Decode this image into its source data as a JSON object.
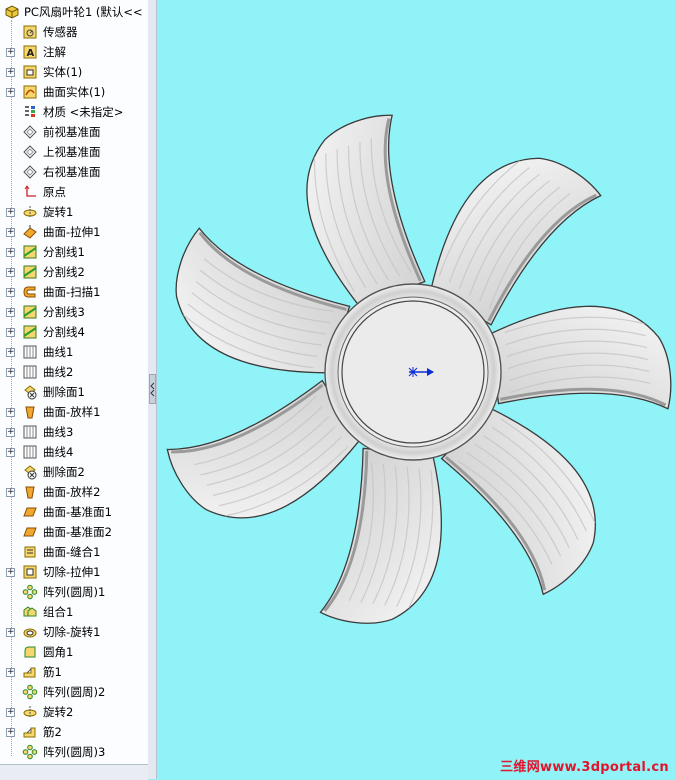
{
  "tree": {
    "root": "PC风扇叶轮1 (默认<<",
    "items": [
      {
        "label": "传感器",
        "icon": "sensor-icon",
        "exp": false
      },
      {
        "label": "注解",
        "icon": "annotation-icon",
        "exp": true
      },
      {
        "label": "实体(1)",
        "icon": "solid-bodies-icon",
        "exp": true
      },
      {
        "label": "曲面实体(1)",
        "icon": "surface-bodies-icon",
        "exp": true
      },
      {
        "label": "材质 <未指定>",
        "icon": "material-icon",
        "exp": false
      },
      {
        "label": "前视基准面",
        "icon": "plane-icon",
        "exp": false
      },
      {
        "label": "上视基准面",
        "icon": "plane-icon",
        "exp": false
      },
      {
        "label": "右视基准面",
        "icon": "plane-icon",
        "exp": false
      },
      {
        "label": "原点",
        "icon": "origin-icon",
        "exp": false
      },
      {
        "label": "旋转1",
        "icon": "revolve-icon",
        "exp": true
      },
      {
        "label": "曲面-拉伸1",
        "icon": "surface-extrude-icon",
        "exp": true
      },
      {
        "label": "分割线1",
        "icon": "split-line-icon",
        "exp": true
      },
      {
        "label": "分割线2",
        "icon": "split-line-icon",
        "exp": true
      },
      {
        "label": "曲面-扫描1",
        "icon": "surface-sweep-icon",
        "exp": true
      },
      {
        "label": "分割线3",
        "icon": "split-line-icon",
        "exp": true
      },
      {
        "label": "分割线4",
        "icon": "split-line-icon",
        "exp": true
      },
      {
        "label": "曲线1",
        "icon": "curve-icon",
        "exp": true
      },
      {
        "label": "曲线2",
        "icon": "curve-icon",
        "exp": true
      },
      {
        "label": "删除面1",
        "icon": "delete-face-icon",
        "exp": false
      },
      {
        "label": "曲面-放样1",
        "icon": "surface-loft-icon",
        "exp": true
      },
      {
        "label": "曲线3",
        "icon": "curve-icon",
        "exp": true
      },
      {
        "label": "曲线4",
        "icon": "curve-icon",
        "exp": true
      },
      {
        "label": "删除面2",
        "icon": "delete-face-icon",
        "exp": false
      },
      {
        "label": "曲面-放样2",
        "icon": "surface-loft-icon",
        "exp": true
      },
      {
        "label": "曲面-基准面1",
        "icon": "planar-surface-icon",
        "exp": false
      },
      {
        "label": "曲面-基准面2",
        "icon": "planar-surface-icon",
        "exp": false
      },
      {
        "label": "曲面-缝合1",
        "icon": "knit-surface-icon",
        "exp": false
      },
      {
        "label": "切除-拉伸1",
        "icon": "cut-extrude-icon",
        "exp": true
      },
      {
        "label": "阵列(圆周)1",
        "icon": "circular-pattern-icon",
        "exp": false
      },
      {
        "label": "组合1",
        "icon": "combine-icon",
        "exp": false
      },
      {
        "label": "切除-旋转1",
        "icon": "cut-revolve-icon",
        "exp": true
      },
      {
        "label": "圆角1",
        "icon": "fillet-icon",
        "exp": false
      },
      {
        "label": "筋1",
        "icon": "rib-icon",
        "exp": true
      },
      {
        "label": "阵列(圆周)2",
        "icon": "circular-pattern-icon",
        "exp": false
      },
      {
        "label": "旋转2",
        "icon": "revolve-icon",
        "exp": true
      },
      {
        "label": "筋2",
        "icon": "rib-icon",
        "exp": true
      },
      {
        "label": "阵列(圆周)3",
        "icon": "circular-pattern-icon",
        "exp": false
      }
    ]
  },
  "model": {
    "blade_count": 7
  },
  "watermark": "三维网www.3dportal.cn",
  "colors": {
    "viewport_bg": "#8ff3f8",
    "watermark": "#e2142b"
  }
}
